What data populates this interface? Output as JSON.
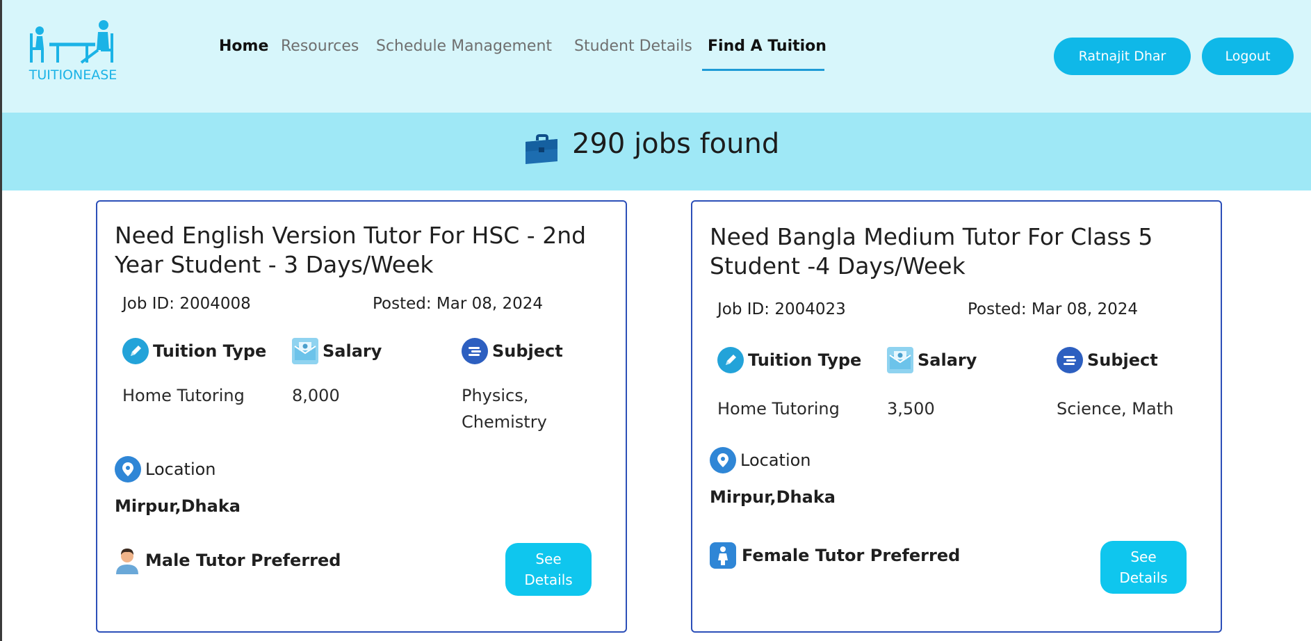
{
  "brand": {
    "name": "TUITIONEASE"
  },
  "nav": {
    "items": [
      {
        "label": "Home"
      },
      {
        "label": "Resources"
      },
      {
        "label": "Schedule Management"
      },
      {
        "label": "Student Details"
      },
      {
        "label": "Find A Tuition"
      }
    ],
    "active": "Find A Tuition"
  },
  "user": {
    "name": "Ratnajit Dhar",
    "logout_label": "Logout"
  },
  "banner": {
    "title": "290 jobs found",
    "icon": "briefcase-icon"
  },
  "colors": {
    "accent": "#0fb8e8",
    "header_bg": "#d7f6fb",
    "banner_bg": "#9fe8f6",
    "card_border": "#2c4fb8"
  },
  "jobs": [
    {
      "title": "Need English Version Tutor For HSC - 2nd Year Student - 3 Days/Week",
      "job_id": "Job ID: 2004008",
      "posted": "Posted: Mar 08, 2024",
      "tuition_type_label": "Tuition Type",
      "tuition_type": "Home Tutoring",
      "salary_label": "Salary",
      "salary": "8,000",
      "subject_label": "Subject",
      "subject": "Physics, Chemistry",
      "location_label": "Location",
      "location": "Mirpur,Dhaka",
      "preference": "Male Tutor Preferred",
      "preference_icon": "male-tutor-icon",
      "details_label": "See Details"
    },
    {
      "title": "Need Bangla Medium Tutor For Class 5 Student -4 Days/Week",
      "job_id": "Job ID: 2004023",
      "posted": "Posted: Mar 08, 2024",
      "tuition_type_label": "Tuition Type",
      "tuition_type": "Home Tutoring",
      "salary_label": "Salary",
      "salary": "3,500",
      "subject_label": "Subject",
      "subject": "Science, Math",
      "location_label": "Location",
      "location": "Mirpur,Dhaka",
      "preference": "Female Tutor Preferred",
      "preference_icon": "female-tutor-icon",
      "details_label": "See Details"
    }
  ]
}
